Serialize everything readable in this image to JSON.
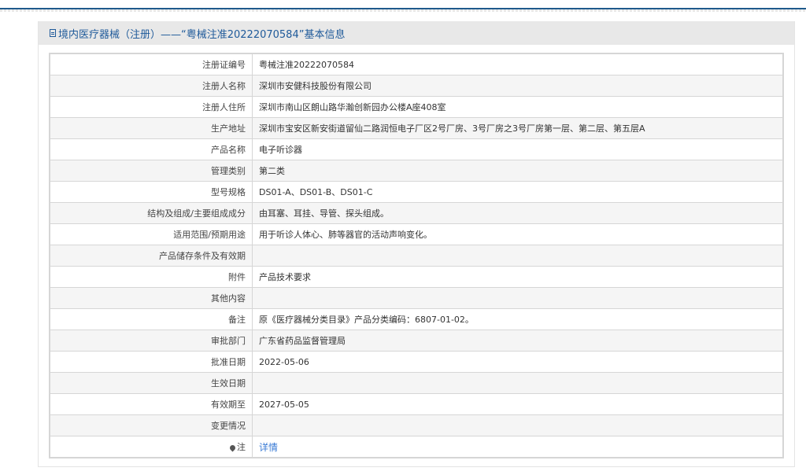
{
  "header": {
    "title": "境内医疗器械（注册）——“粤械注准20222070584”基本信息",
    "icon": "document-icon"
  },
  "rows": [
    {
      "label": "注册证编号",
      "value": "粤械注准20222070584"
    },
    {
      "label": "注册人名称",
      "value": "深圳市安健科技股份有限公司"
    },
    {
      "label": "注册人住所",
      "value": "深圳市南山区朗山路华瀚创新园办公楼A座408室"
    },
    {
      "label": "生产地址",
      "value": "深圳市宝安区新安街道留仙二路润恒电子厂区2号厂房、3号厂房之3号厂房第一层、第二层、第五层A"
    },
    {
      "label": "产品名称",
      "value": "电子听诊器"
    },
    {
      "label": "管理类别",
      "value": "第二类"
    },
    {
      "label": "型号规格",
      "value": "DS01-A、DS01-B、DS01-C"
    },
    {
      "label": "结构及组成/主要组成成分",
      "value": "由耳塞、耳挂、导管、探头组成。"
    },
    {
      "label": "适用范围/预期用途",
      "value": "用于听诊人体心、肺等器官的活动声响变化。"
    },
    {
      "label": "产品储存条件及有效期",
      "value": ""
    },
    {
      "label": "附件",
      "value": "产品技术要求"
    },
    {
      "label": "其他内容",
      "value": ""
    },
    {
      "label": "备注",
      "value": "原《医疗器械分类目录》产品分类编码：6807-01-02。"
    },
    {
      "label": "审批部门",
      "value": "广东省药品监督管理局"
    },
    {
      "label": "批准日期",
      "value": "2022-05-06"
    },
    {
      "label": "生效日期",
      "value": ""
    },
    {
      "label": "有效期至",
      "value": "2027-05-05"
    },
    {
      "label": "变更情况",
      "value": ""
    }
  ],
  "note": {
    "label": "注",
    "link": "详情"
  }
}
